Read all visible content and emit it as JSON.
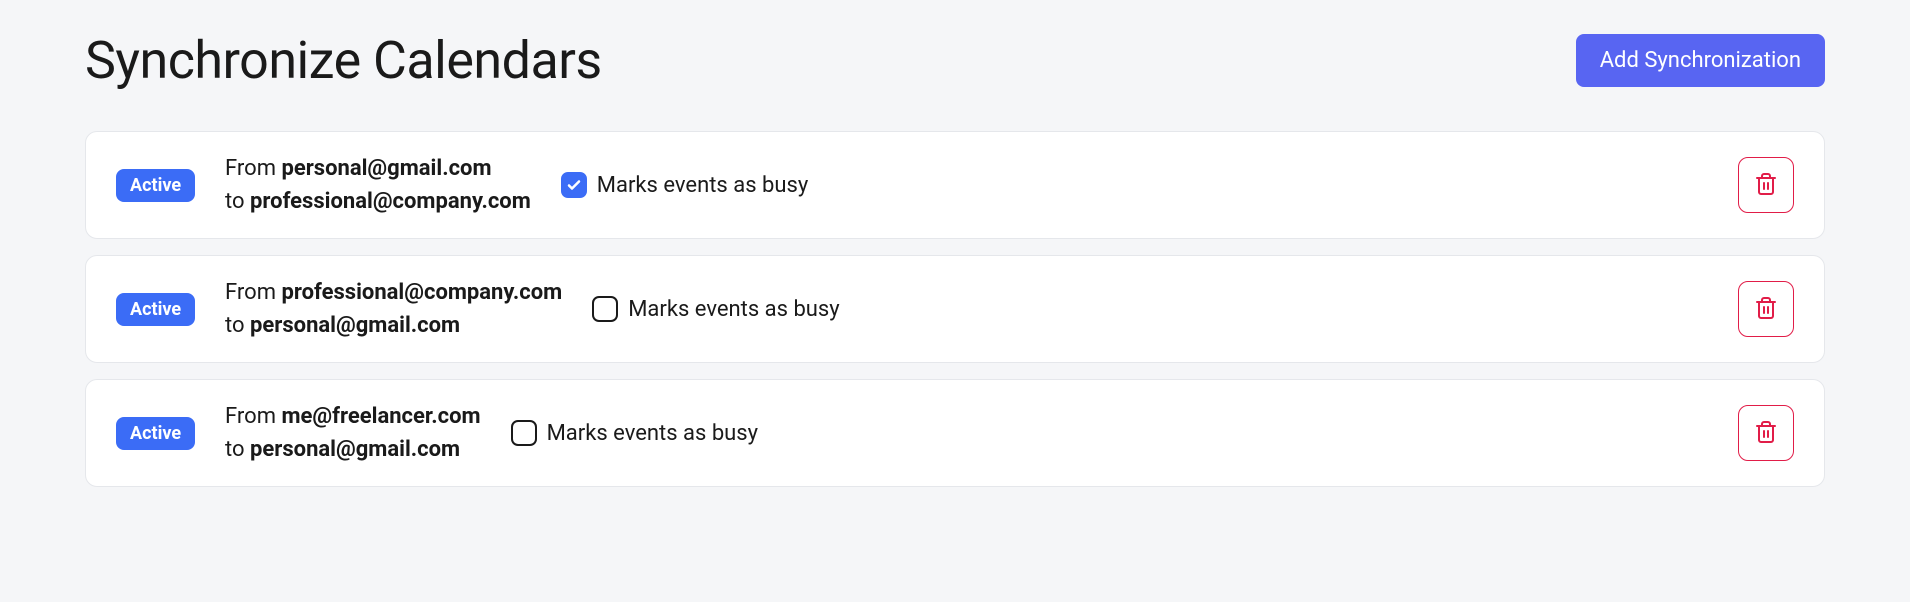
{
  "header": {
    "title": "Synchronize Calendars",
    "add_label": "Add Synchronization"
  },
  "labels": {
    "from_prefix": "From ",
    "to_prefix": "to ",
    "busy_label": "Marks events as busy"
  },
  "syncs": [
    {
      "status": "Active",
      "from": "personal@gmail.com",
      "to": "professional@company.com",
      "marks_busy": true
    },
    {
      "status": "Active",
      "from": "professional@company.com",
      "to": "personal@gmail.com",
      "marks_busy": false
    },
    {
      "status": "Active",
      "from": "me@freelancer.com",
      "to": "personal@gmail.com",
      "marks_busy": false
    }
  ]
}
